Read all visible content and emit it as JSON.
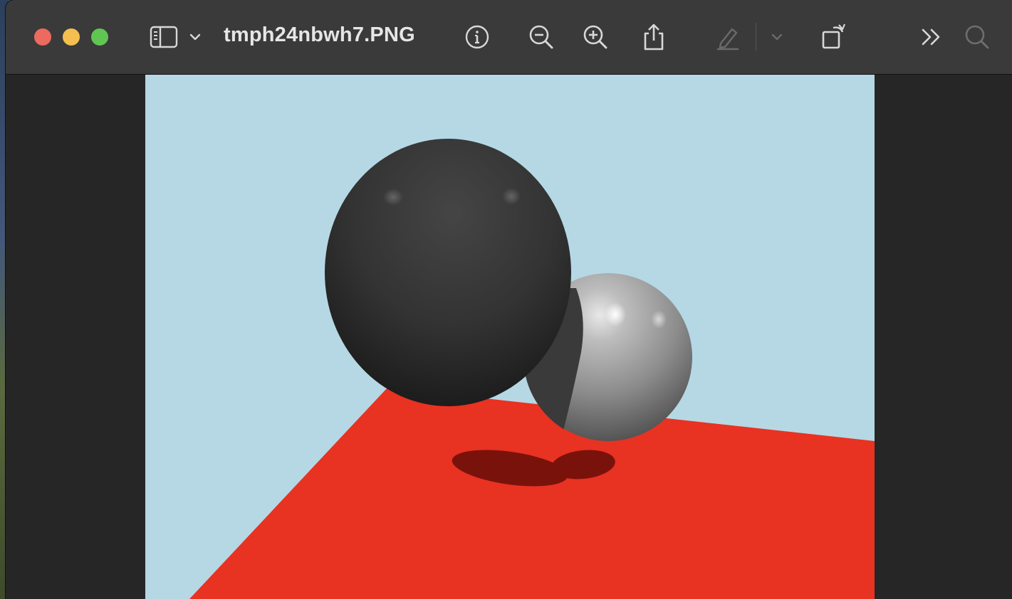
{
  "window": {
    "title": "tmph24nbwh7.PNG"
  },
  "toolbar": {
    "icons": [
      "sidebar-icon",
      "chevron-down-icon",
      "info-icon",
      "zoom-out-icon",
      "zoom-in-icon",
      "share-icon",
      "markup-pen-icon",
      "markup-chevron-icon",
      "rotate-icon",
      "more-icon",
      "search-icon"
    ]
  },
  "colors": {
    "sky": "#b5d8e4",
    "floor": "#e83222",
    "shadow": "#7a120c",
    "sphere_dark": "#383838",
    "sphere_light": "#a8a8a8",
    "titlebar": "#3a3a3a"
  }
}
